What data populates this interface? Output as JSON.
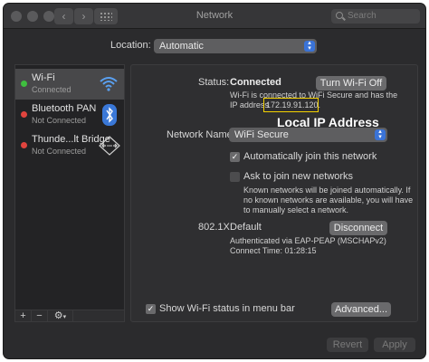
{
  "window": {
    "title": "Network",
    "search_placeholder": "Search"
  },
  "location": {
    "label": "Location:",
    "value": "Automatic"
  },
  "services": [
    {
      "name": "Wi-Fi",
      "status": "Connected",
      "dot": "#3fbf3f",
      "icon": "wifi-icon"
    },
    {
      "name": "Bluetooth PAN",
      "status": "Not Connected",
      "dot": "#e0443e",
      "icon": "bluetooth-icon"
    },
    {
      "name": "Thunde...lt Bridge",
      "status": "Not Connected",
      "dot": "#e0443e",
      "icon": "thunderbolt-icon"
    }
  ],
  "sidebar_controls": {
    "add": "+",
    "remove": "−",
    "gear": "⚙"
  },
  "status": {
    "label": "Status:",
    "value": "Connected",
    "turn_off_button": "Turn Wi-Fi Off",
    "detail_1": "Wi-Fi is connected to WiFi Secure and has the",
    "detail_2_prefix": "IP address",
    "ip": "172.19.91.120."
  },
  "annotation": {
    "label": "Local IP Address",
    "color": "#f5d200"
  },
  "network_name": {
    "label": "Network Name:",
    "value": "WiFi Secure"
  },
  "auto_join": {
    "label": "Automatically join this network",
    "checked": true
  },
  "ask_join": {
    "label": "Ask to join new networks",
    "checked": false,
    "help_1": "Known networks will be joined automatically. If",
    "help_2": "no known networks are available, you will have",
    "help_3": "to manually select a network."
  },
  "dot1x": {
    "label": "802.1X:",
    "value": "Default",
    "disconnect_button": "Disconnect",
    "auth": "Authenticated via EAP-PEAP (MSCHAPv2)",
    "connect_time": "Connect Time: 01:28:15"
  },
  "menubar_status": {
    "label": "Show Wi-Fi status in menu bar",
    "checked": true
  },
  "advanced_button": "Advanced...",
  "footer": {
    "revert": "Revert",
    "apply": "Apply"
  }
}
